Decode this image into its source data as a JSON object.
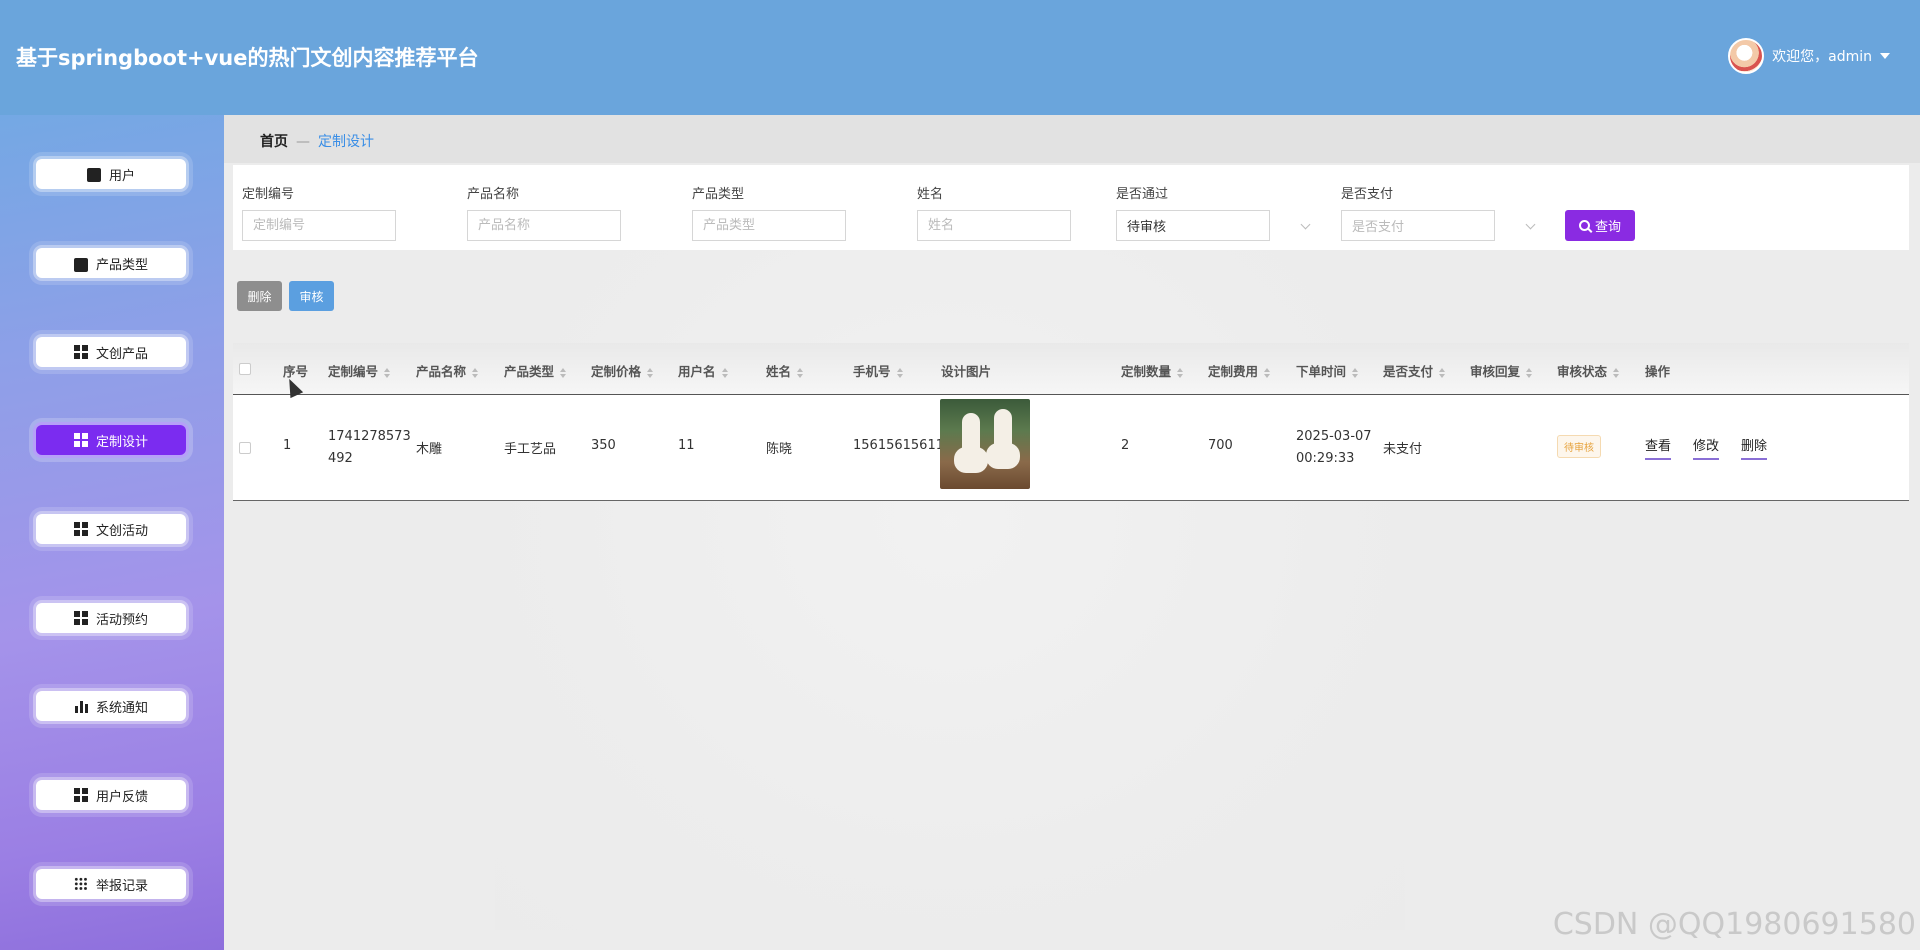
{
  "header": {
    "title": "基于springboot+vue的热门文创内容推荐平台",
    "user_greeting": "欢迎您，admin"
  },
  "sidebar": {
    "items": [
      {
        "label": "用户",
        "icon": "ticket-icon"
      },
      {
        "label": "产品类型",
        "icon": "bag-icon"
      },
      {
        "label": "文创产品",
        "icon": "grid-icon"
      },
      {
        "label": "定制设计",
        "icon": "grid-icon",
        "active": true
      },
      {
        "label": "文创活动",
        "icon": "grid-icon"
      },
      {
        "label": "活动预约",
        "icon": "grid-icon"
      },
      {
        "label": "系统通知",
        "icon": "bar-chart-icon"
      },
      {
        "label": "用户反馈",
        "icon": "grid-icon"
      },
      {
        "label": "举报记录",
        "icon": "dots-grid-icon"
      }
    ]
  },
  "breadcrumb": {
    "home": "首页",
    "separator": "—",
    "current": "定制设计"
  },
  "search": {
    "fields": [
      {
        "label": "定制编号",
        "placeholder": "定制编号"
      },
      {
        "label": "产品名称",
        "placeholder": "产品名称"
      },
      {
        "label": "产品类型",
        "placeholder": "产品类型"
      },
      {
        "label": "姓名",
        "placeholder": "姓名"
      }
    ],
    "pass_label": "是否通过",
    "pass_value": "待审核",
    "pay_label": "是否支付",
    "pay_placeholder": "是否支付",
    "query_label": "查询"
  },
  "actions": {
    "delete_label": "删除",
    "audit_label": "审核"
  },
  "table": {
    "columns": [
      "序号",
      "定制编号",
      "产品名称",
      "产品类型",
      "定制价格",
      "用户名",
      "姓名",
      "手机号",
      "设计图片",
      "定制数量",
      "定制费用",
      "下单时间",
      "是否支付",
      "审核回复",
      "审核状态",
      "操作"
    ],
    "rows": [
      {
        "index": "1",
        "code": "1741278573492",
        "product_name": "木雕",
        "product_type": "手工艺品",
        "price": "350",
        "username": "11",
        "name": "陈晓",
        "phone": "15615615611",
        "quantity": "2",
        "fee": "700",
        "order_time": "2025-03-07 00:29:33",
        "paid": "未支付",
        "reply": "",
        "status": "待审核",
        "ops": [
          "查看",
          "修改",
          "删除"
        ]
      }
    ]
  },
  "watermark": "CSDN @QQ1980691580",
  "colors": {
    "header": "#6aa5dc",
    "accent": "#8a2be2",
    "active_menu": "#7b2cf0",
    "link": "#3a8ee6"
  }
}
